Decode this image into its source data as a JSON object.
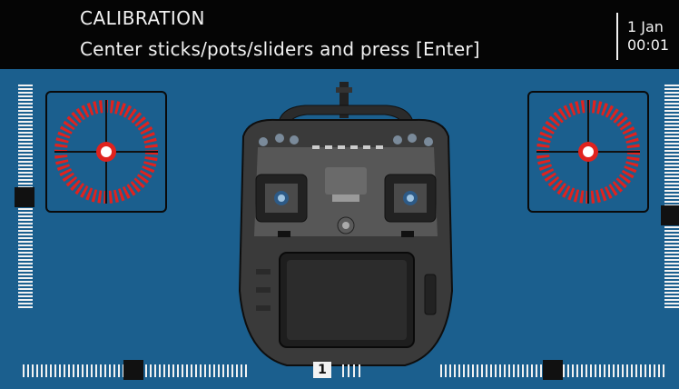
{
  "header": {
    "title": "CALIBRATION",
    "subtitle": "Center sticks/pots/sliders and press [Enter]",
    "date": "1 Jan",
    "time": "00:01"
  },
  "left_stick": {
    "x": 0.0,
    "y": 0.0
  },
  "right_stick": {
    "x": 0.0,
    "y": 0.0
  },
  "left_slider_level": 0.5,
  "right_slider_level": 0.5,
  "pot1_level": 0.5,
  "pot2_level": 0.5,
  "trim_label": "1",
  "colors": {
    "background": "#1b5f8e",
    "header": "#050505",
    "ring": "#e0221e",
    "thumb": "#111111"
  },
  "icons": {
    "radio": "transmitter-image"
  }
}
